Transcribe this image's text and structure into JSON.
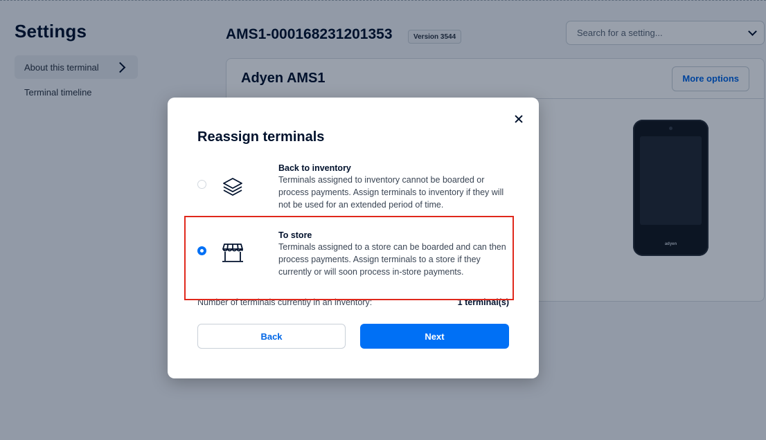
{
  "page": {
    "title": "Settings"
  },
  "sidebar": {
    "items": [
      {
        "label": "About this terminal"
      },
      {
        "label": "Terminal timeline"
      }
    ]
  },
  "header": {
    "terminal_id": "AMS1-000168231201353",
    "version_badge": "Version 3544",
    "search_placeholder": "Search for a setting..."
  },
  "card": {
    "title": "Adyen AMS1",
    "more_options_label": "More options",
    "device_brand": "adyen"
  },
  "modal": {
    "title": "Reassign terminals",
    "options": [
      {
        "title": "Back to inventory",
        "description": "Terminals assigned to inventory cannot be boarded or process payments. Assign terminals to inventory if they will not be used for an extended period of time.",
        "icon": "layers-icon",
        "selected": false
      },
      {
        "title": "To store",
        "description": "Terminals assigned to a store can be boarded and can then process payments. Assign terminals to a store if they currently or will soon process in-store payments.",
        "icon": "storefront-icon",
        "selected": true
      }
    ],
    "count_label": "Number of terminals currently in an inventory:",
    "count_value": "1 terminal(s)",
    "back_label": "Back",
    "next_label": "Next"
  },
  "colors": {
    "primary": "#0070f5",
    "highlight": "#e0281b",
    "text": "#00112c"
  }
}
